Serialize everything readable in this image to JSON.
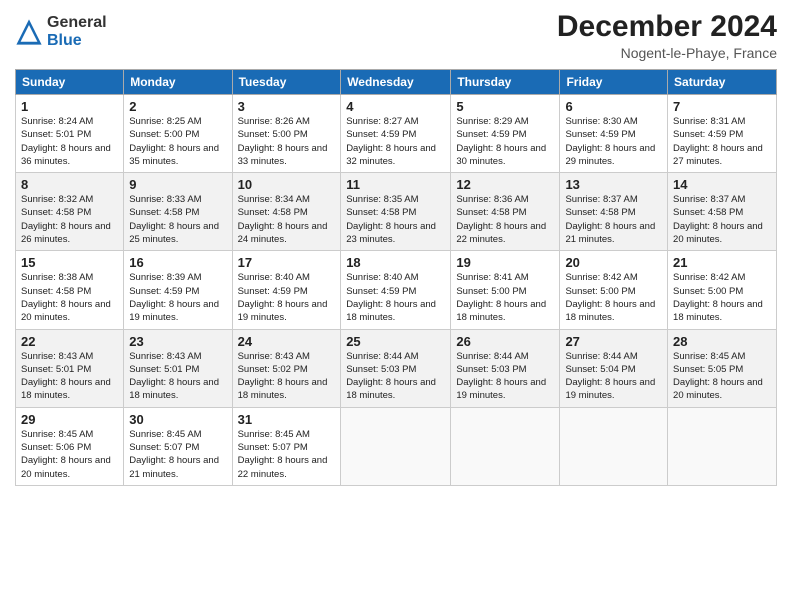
{
  "header": {
    "logo_general": "General",
    "logo_blue": "Blue",
    "month_title": "December 2024",
    "location": "Nogent-le-Phaye, France"
  },
  "days_of_week": [
    "Sunday",
    "Monday",
    "Tuesday",
    "Wednesday",
    "Thursday",
    "Friday",
    "Saturday"
  ],
  "weeks": [
    [
      {
        "day": "1",
        "sunrise": "8:24 AM",
        "sunset": "5:01 PM",
        "daylight": "8 hours and 36 minutes."
      },
      {
        "day": "2",
        "sunrise": "8:25 AM",
        "sunset": "5:00 PM",
        "daylight": "8 hours and 35 minutes."
      },
      {
        "day": "3",
        "sunrise": "8:26 AM",
        "sunset": "5:00 PM",
        "daylight": "8 hours and 33 minutes."
      },
      {
        "day": "4",
        "sunrise": "8:27 AM",
        "sunset": "4:59 PM",
        "daylight": "8 hours and 32 minutes."
      },
      {
        "day": "5",
        "sunrise": "8:29 AM",
        "sunset": "4:59 PM",
        "daylight": "8 hours and 30 minutes."
      },
      {
        "day": "6",
        "sunrise": "8:30 AM",
        "sunset": "4:59 PM",
        "daylight": "8 hours and 29 minutes."
      },
      {
        "day": "7",
        "sunrise": "8:31 AM",
        "sunset": "4:59 PM",
        "daylight": "8 hours and 27 minutes."
      }
    ],
    [
      {
        "day": "8",
        "sunrise": "8:32 AM",
        "sunset": "4:58 PM",
        "daylight": "8 hours and 26 minutes."
      },
      {
        "day": "9",
        "sunrise": "8:33 AM",
        "sunset": "4:58 PM",
        "daylight": "8 hours and 25 minutes."
      },
      {
        "day": "10",
        "sunrise": "8:34 AM",
        "sunset": "4:58 PM",
        "daylight": "8 hours and 24 minutes."
      },
      {
        "day": "11",
        "sunrise": "8:35 AM",
        "sunset": "4:58 PM",
        "daylight": "8 hours and 23 minutes."
      },
      {
        "day": "12",
        "sunrise": "8:36 AM",
        "sunset": "4:58 PM",
        "daylight": "8 hours and 22 minutes."
      },
      {
        "day": "13",
        "sunrise": "8:37 AM",
        "sunset": "4:58 PM",
        "daylight": "8 hours and 21 minutes."
      },
      {
        "day": "14",
        "sunrise": "8:37 AM",
        "sunset": "4:58 PM",
        "daylight": "8 hours and 20 minutes."
      }
    ],
    [
      {
        "day": "15",
        "sunrise": "8:38 AM",
        "sunset": "4:58 PM",
        "daylight": "8 hours and 20 minutes."
      },
      {
        "day": "16",
        "sunrise": "8:39 AM",
        "sunset": "4:59 PM",
        "daylight": "8 hours and 19 minutes."
      },
      {
        "day": "17",
        "sunrise": "8:40 AM",
        "sunset": "4:59 PM",
        "daylight": "8 hours and 19 minutes."
      },
      {
        "day": "18",
        "sunrise": "8:40 AM",
        "sunset": "4:59 PM",
        "daylight": "8 hours and 18 minutes."
      },
      {
        "day": "19",
        "sunrise": "8:41 AM",
        "sunset": "5:00 PM",
        "daylight": "8 hours and 18 minutes."
      },
      {
        "day": "20",
        "sunrise": "8:42 AM",
        "sunset": "5:00 PM",
        "daylight": "8 hours and 18 minutes."
      },
      {
        "day": "21",
        "sunrise": "8:42 AM",
        "sunset": "5:00 PM",
        "daylight": "8 hours and 18 minutes."
      }
    ],
    [
      {
        "day": "22",
        "sunrise": "8:43 AM",
        "sunset": "5:01 PM",
        "daylight": "8 hours and 18 minutes."
      },
      {
        "day": "23",
        "sunrise": "8:43 AM",
        "sunset": "5:01 PM",
        "daylight": "8 hours and 18 minutes."
      },
      {
        "day": "24",
        "sunrise": "8:43 AM",
        "sunset": "5:02 PM",
        "daylight": "8 hours and 18 minutes."
      },
      {
        "day": "25",
        "sunrise": "8:44 AM",
        "sunset": "5:03 PM",
        "daylight": "8 hours and 18 minutes."
      },
      {
        "day": "26",
        "sunrise": "8:44 AM",
        "sunset": "5:03 PM",
        "daylight": "8 hours and 19 minutes."
      },
      {
        "day": "27",
        "sunrise": "8:44 AM",
        "sunset": "5:04 PM",
        "daylight": "8 hours and 19 minutes."
      },
      {
        "day": "28",
        "sunrise": "8:45 AM",
        "sunset": "5:05 PM",
        "daylight": "8 hours and 20 minutes."
      }
    ],
    [
      {
        "day": "29",
        "sunrise": "8:45 AM",
        "sunset": "5:06 PM",
        "daylight": "8 hours and 20 minutes."
      },
      {
        "day": "30",
        "sunrise": "8:45 AM",
        "sunset": "5:07 PM",
        "daylight": "8 hours and 21 minutes."
      },
      {
        "day": "31",
        "sunrise": "8:45 AM",
        "sunset": "5:07 PM",
        "daylight": "8 hours and 22 minutes."
      },
      null,
      null,
      null,
      null
    ]
  ]
}
